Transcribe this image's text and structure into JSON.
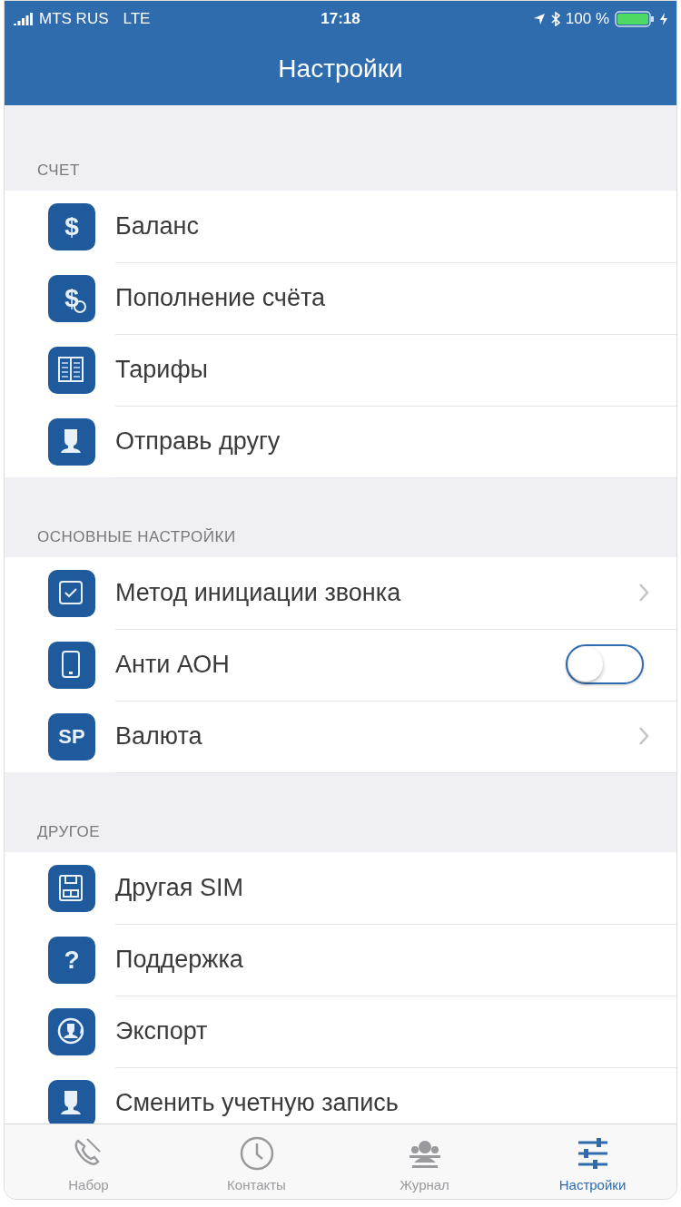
{
  "status_bar": {
    "carrier": "MTS RUS",
    "network": "LTE",
    "time": "17:18",
    "battery": "100 %"
  },
  "nav": {
    "title": "Настройки"
  },
  "sections": [
    {
      "header": "СЧЕТ",
      "items": [
        {
          "label": "Баланс",
          "kind": "plain",
          "icon_text": "$"
        },
        {
          "label": "Пополнение счёта",
          "kind": "plain",
          "icon_text": "$"
        },
        {
          "label": "Тарифы",
          "kind": "plain"
        },
        {
          "label": "Отправь другу",
          "kind": "plain"
        }
      ]
    },
    {
      "header": "ОСНОВНЫЕ НАСТРОЙКИ",
      "items": [
        {
          "label": "Метод инициации звонка",
          "kind": "chevron"
        },
        {
          "label": "Анти АОН",
          "kind": "toggle",
          "on": false
        },
        {
          "label": "Валюта",
          "kind": "chevron",
          "icon_text": "SP"
        }
      ]
    },
    {
      "header": "ДРУГОЕ",
      "items": [
        {
          "label": "Другая SIM",
          "kind": "plain"
        },
        {
          "label": "Поддержка",
          "kind": "plain",
          "icon_text": "?"
        },
        {
          "label": "Экспорт",
          "kind": "plain"
        },
        {
          "label": "Сменить учетную запись",
          "kind": "plain"
        }
      ]
    }
  ],
  "tab_bar": [
    {
      "label": "Набор",
      "selected": false
    },
    {
      "label": "Контакты",
      "selected": false
    },
    {
      "label": "Журнал",
      "selected": false
    },
    {
      "label": "Настройки",
      "selected": true
    }
  ]
}
